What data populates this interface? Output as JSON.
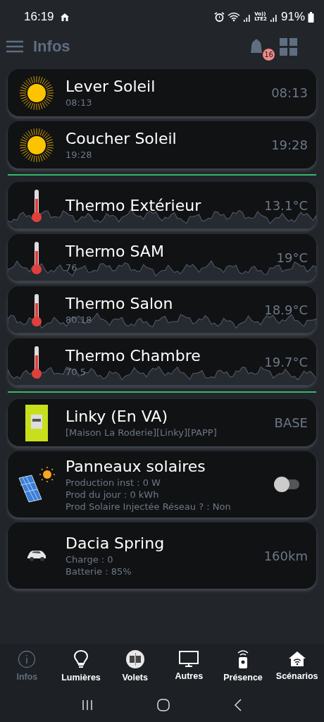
{
  "status_bar": {
    "time": "16:19",
    "volte": [
      "Vo))",
      "LTE2"
    ],
    "battery": "91%"
  },
  "header": {
    "title": "Infos",
    "notification_count": "16"
  },
  "groups": [
    [
      {
        "kind": "sun",
        "title": "Lever Soleil",
        "lines": [
          "08:13"
        ],
        "value": "08:13"
      },
      {
        "kind": "sun",
        "title": "Coucher Soleil",
        "lines": [
          "19:28"
        ],
        "value": "19:28"
      }
    ],
    [
      {
        "kind": "thermo",
        "title": "Thermo Extérieur",
        "value": "13.1°C"
      },
      {
        "kind": "thermo",
        "title": "Thermo SAM",
        "lines": [
          "76"
        ],
        "value": "19°C"
      },
      {
        "kind": "thermo",
        "title": "Thermo Salon",
        "lines": [
          "80.18"
        ],
        "value": "18.9°C"
      },
      {
        "kind": "thermo",
        "title": "Thermo Chambre",
        "lines": [
          "70.5"
        ],
        "value": "19.7°C"
      }
    ],
    [
      {
        "kind": "meter",
        "title": "Linky (En VA)",
        "lines": [
          "[Maison La Roderie][Linky][PAPP]"
        ],
        "value": "BASE"
      },
      {
        "kind": "solar",
        "title": "Panneaux solaires",
        "lines": [
          "Production inst : 0 W",
          "Prod du jour : 0 kWh",
          "Prod Solaire Injectée Réseau ? : Non"
        ],
        "on": false
      },
      {
        "kind": "car",
        "title": "Dacia Spring",
        "lines": [
          "Charge : 0",
          "Batterie : 85%"
        ],
        "value": "160km"
      }
    ]
  ],
  "bottom_nav": [
    {
      "kind": "info",
      "label": "Infos",
      "selected": true
    },
    {
      "kind": "bulb",
      "label": "Lumières",
      "selected": false
    },
    {
      "kind": "shutter",
      "label": "Volets",
      "selected": false
    },
    {
      "kind": "monitor",
      "label": "Autres",
      "selected": false
    },
    {
      "kind": "presence",
      "label": "Présence",
      "selected": false
    },
    {
      "kind": "home",
      "label": "Scénarios",
      "selected": false
    }
  ]
}
